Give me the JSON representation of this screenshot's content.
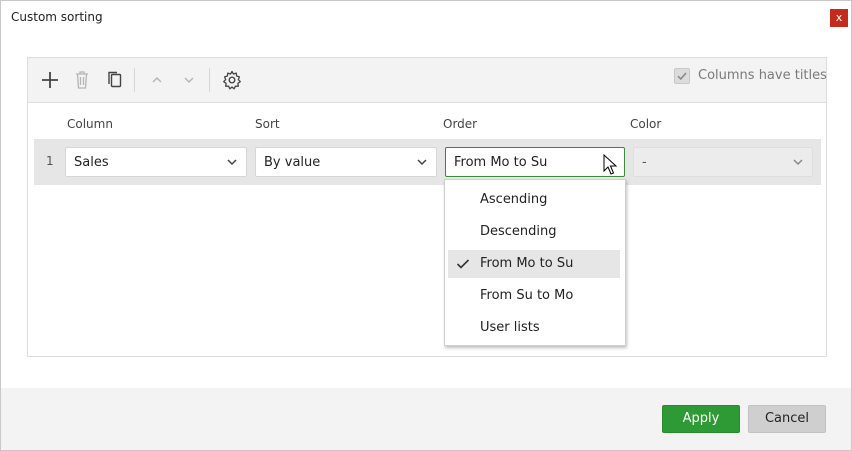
{
  "window": {
    "title": "Custom sorting",
    "close_glyph": "x"
  },
  "toolbar": {
    "icons": [
      "plus-icon",
      "trash-icon",
      "copy-icon",
      "chevron-up-icon",
      "chevron-down-icon",
      "gear-icon"
    ],
    "columns_have_titles": {
      "label": "Columns have titles",
      "checked": true
    }
  },
  "columns": {
    "column": "Column",
    "sort": "Sort",
    "order": "Order",
    "color": "Color"
  },
  "rows": [
    {
      "number": "1",
      "column": "Sales",
      "sort": "By value",
      "order": "From Mo to Su",
      "color": "-"
    }
  ],
  "order_options": {
    "items": [
      "Ascending",
      "Descending",
      "From Mo to Su",
      "From Su to Mo",
      "User lists"
    ],
    "selected": "From Mo to Su"
  },
  "footer": {
    "apply_label": "Apply",
    "cancel_label": "Cancel"
  },
  "colors": {
    "accent": "#2e9a35",
    "close": "#c42b1c"
  }
}
